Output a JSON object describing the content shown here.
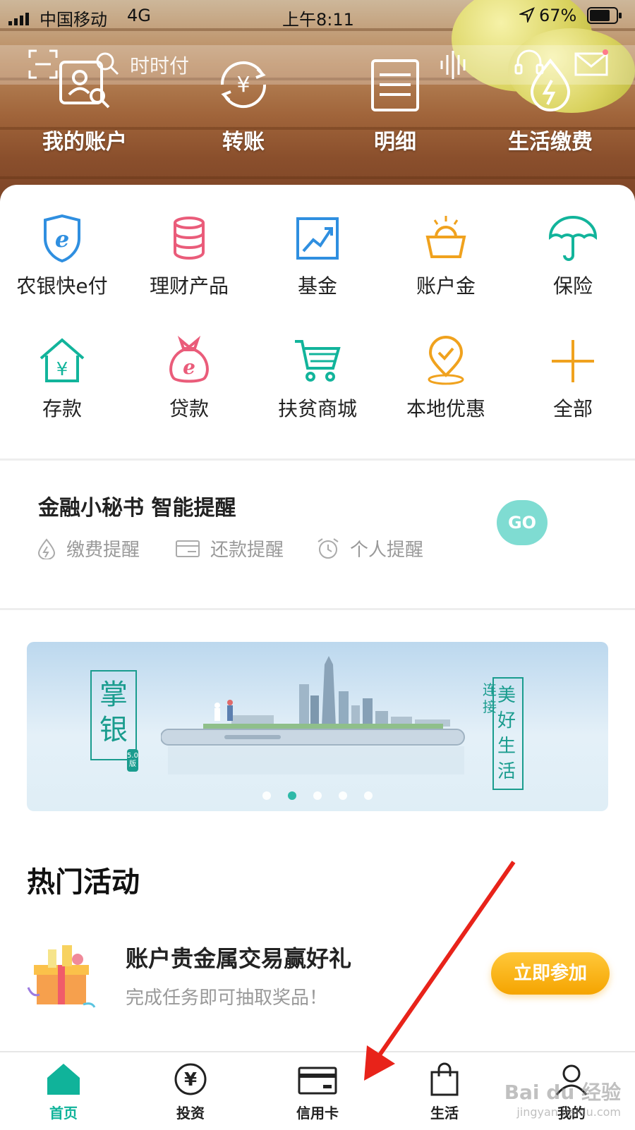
{
  "status_bar": {
    "carrier": "中国移动",
    "network": "4G",
    "time": "上午8:11",
    "battery": "67%"
  },
  "search": {
    "placeholder": "时时付"
  },
  "quick_actions": [
    {
      "label": "我的账户",
      "icon": "account-search-icon"
    },
    {
      "label": "转账",
      "icon": "transfer-icon"
    },
    {
      "label": "明细",
      "icon": "statement-icon"
    },
    {
      "label": "生活缴费",
      "icon": "utility-payment-icon"
    }
  ],
  "services": [
    {
      "label": "农银快e付",
      "icon": "shield-e-icon",
      "color": "#2f8fe0"
    },
    {
      "label": "理财产品",
      "icon": "coins-stack-icon",
      "color": "#ea5c7a"
    },
    {
      "label": "基金",
      "icon": "fund-chart-icon",
      "color": "#2f8fe0"
    },
    {
      "label": "账户金",
      "icon": "gold-basket-icon",
      "color": "#f0a21e"
    },
    {
      "label": "保险",
      "icon": "umbrella-icon",
      "color": "#12b49b"
    },
    {
      "label": "存款",
      "icon": "deposit-house-icon",
      "color": "#12b49b"
    },
    {
      "label": "贷款",
      "icon": "loan-bag-icon",
      "color": "#ea5c7a"
    },
    {
      "label": "扶贫商城",
      "icon": "shopping-cart-icon",
      "color": "#12b49b"
    },
    {
      "label": "本地优惠",
      "icon": "location-pin-icon",
      "color": "#f0a21e"
    },
    {
      "label": "全部",
      "icon": "plus-icon",
      "color": "#f0a21e"
    }
  ],
  "secretary": {
    "title": "金融小秘书 智能提醒",
    "items": [
      "缴费提醒",
      "还款提醒",
      "个人提醒"
    ],
    "go_label": "GO"
  },
  "banner": {
    "left_text": "掌银",
    "version": "5.0版",
    "right_small": "连接",
    "right_text": "美好生活",
    "slide_count": 5,
    "active_slide": 2
  },
  "hot": {
    "title": "热门活动",
    "activity_title": "账户贵金属交易赢好礼",
    "activity_sub": "完成任务即可抽取奖品！",
    "join_label": "立即参加"
  },
  "tabs": [
    {
      "label": "首页",
      "icon": "home-icon",
      "active": true
    },
    {
      "label": "投资",
      "icon": "yen-circle-icon",
      "active": false
    },
    {
      "label": "信用卡",
      "icon": "credit-card-icon",
      "active": false
    },
    {
      "label": "生活",
      "icon": "shopping-bag-icon",
      "active": false
    },
    {
      "label": "我的",
      "icon": "user-icon",
      "active": false
    }
  ],
  "watermark": {
    "line1": "Bai du 经验",
    "line2": "jingyan.baidu.com"
  },
  "colors": {
    "accent": "#10b39a",
    "join_button": "#f5a400",
    "annotation_arrow": "#e8231a"
  }
}
